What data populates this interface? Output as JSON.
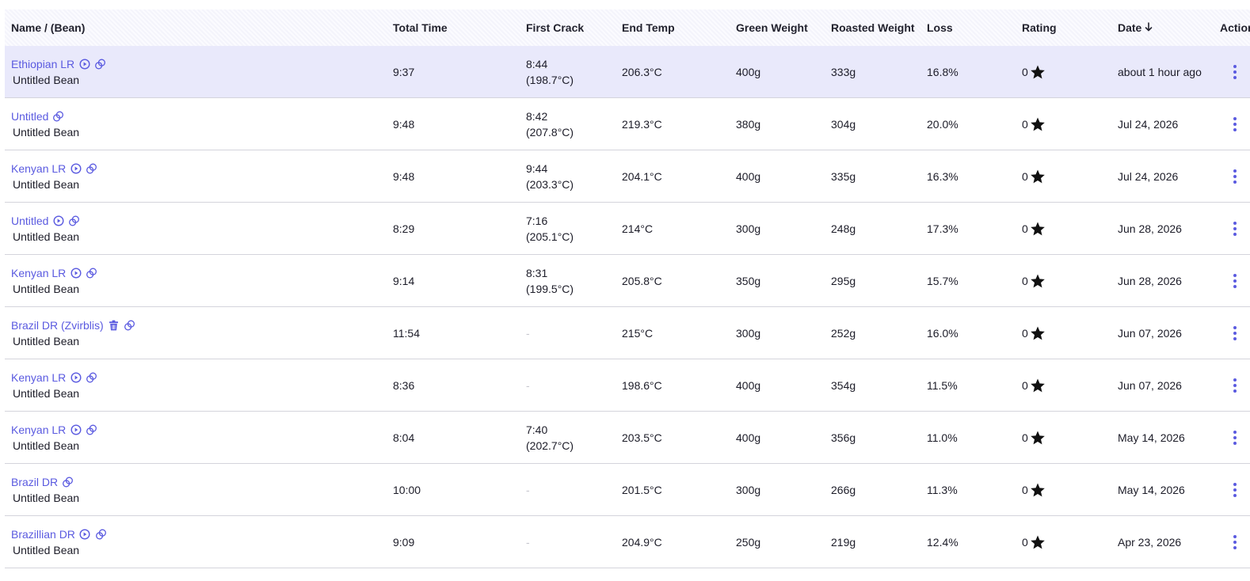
{
  "columns": {
    "name": "Name / (Bean)",
    "total_time": "Total Time",
    "first_crack": "First Crack",
    "end_temp": "End Temp",
    "green_weight": "Green Weight",
    "roasted_weight": "Roasted Weight",
    "loss": "Loss",
    "rating": "Rating",
    "date": "Date",
    "actions": "Actions"
  },
  "sort": {
    "column": "date",
    "direction": "descending",
    "icon": "arrow-down-icon"
  },
  "accent_color": "#5a5ae0",
  "selected_row_color": "#e9e9fb",
  "rows": [
    {
      "name": "Ethiopian LR",
      "bean": "Untitled Bean",
      "has_play": true,
      "has_trash": false,
      "total_time": "9:37",
      "crack_time": "8:44",
      "crack_temp": "(198.7°C)",
      "end_temp": "206.3°C",
      "green": "400g",
      "roasted": "333g",
      "loss": "16.8%",
      "rating": "0",
      "date": "about 1 hour ago",
      "selected": true
    },
    {
      "name": "Untitled",
      "bean": "Untitled Bean",
      "has_play": false,
      "has_trash": false,
      "total_time": "9:48",
      "crack_time": "8:42",
      "crack_temp": "(207.8°C)",
      "end_temp": "219.3°C",
      "green": "380g",
      "roasted": "304g",
      "loss": "20.0%",
      "rating": "0",
      "date": "Jul 24, 2026",
      "selected": false
    },
    {
      "name": "Kenyan LR",
      "bean": "Untitled Bean",
      "has_play": true,
      "has_trash": false,
      "total_time": "9:48",
      "crack_time": "9:44",
      "crack_temp": "(203.3°C)",
      "end_temp": "204.1°C",
      "green": "400g",
      "roasted": "335g",
      "loss": "16.3%",
      "rating": "0",
      "date": "Jul 24, 2026",
      "selected": false
    },
    {
      "name": "Untitled",
      "bean": "Untitled Bean",
      "has_play": true,
      "has_trash": false,
      "total_time": "8:29",
      "crack_time": "7:16",
      "crack_temp": "(205.1°C)",
      "end_temp": "214°C",
      "green": "300g",
      "roasted": "248g",
      "loss": "17.3%",
      "rating": "0",
      "date": "Jun 28, 2026",
      "selected": false
    },
    {
      "name": "Kenyan LR",
      "bean": "Untitled Bean",
      "has_play": true,
      "has_trash": false,
      "total_time": "9:14",
      "crack_time": "8:31",
      "crack_temp": "(199.5°C)",
      "end_temp": "205.8°C",
      "green": "350g",
      "roasted": "295g",
      "loss": "15.7%",
      "rating": "0",
      "date": "Jun 28, 2026",
      "selected": false
    },
    {
      "name": "Brazil DR (Zvirblis)",
      "bean": "Untitled Bean",
      "has_play": false,
      "has_trash": true,
      "total_time": "11:54",
      "crack_time": "-",
      "crack_temp": "",
      "end_temp": "215°C",
      "green": "300g",
      "roasted": "252g",
      "loss": "16.0%",
      "rating": "0",
      "date": "Jun 07, 2026",
      "selected": false
    },
    {
      "name": "Kenyan LR",
      "bean": "Untitled Bean",
      "has_play": true,
      "has_trash": false,
      "total_time": "8:36",
      "crack_time": "-",
      "crack_temp": "",
      "end_temp": "198.6°C",
      "green": "400g",
      "roasted": "354g",
      "loss": "11.5%",
      "rating": "0",
      "date": "Jun 07, 2026",
      "selected": false
    },
    {
      "name": "Kenyan LR",
      "bean": "Untitled Bean",
      "has_play": true,
      "has_trash": false,
      "total_time": "8:04",
      "crack_time": "7:40",
      "crack_temp": "(202.7°C)",
      "end_temp": "203.5°C",
      "green": "400g",
      "roasted": "356g",
      "loss": "11.0%",
      "rating": "0",
      "date": "May 14, 2026",
      "selected": false
    },
    {
      "name": "Brazil DR",
      "bean": "Untitled Bean",
      "has_play": false,
      "has_trash": false,
      "total_time": "10:00",
      "crack_time": "-",
      "crack_temp": "",
      "end_temp": "201.5°C",
      "green": "300g",
      "roasted": "266g",
      "loss": "11.3%",
      "rating": "0",
      "date": "May 14, 2026",
      "selected": false
    },
    {
      "name": "Brazillian DR",
      "bean": "Untitled Bean",
      "has_play": true,
      "has_trash": false,
      "total_time": "9:09",
      "crack_time": "-",
      "crack_temp": "",
      "end_temp": "204.9°C",
      "green": "250g",
      "roasted": "219g",
      "loss": "12.4%",
      "rating": "0",
      "date": "Apr 23, 2026",
      "selected": false
    }
  ]
}
